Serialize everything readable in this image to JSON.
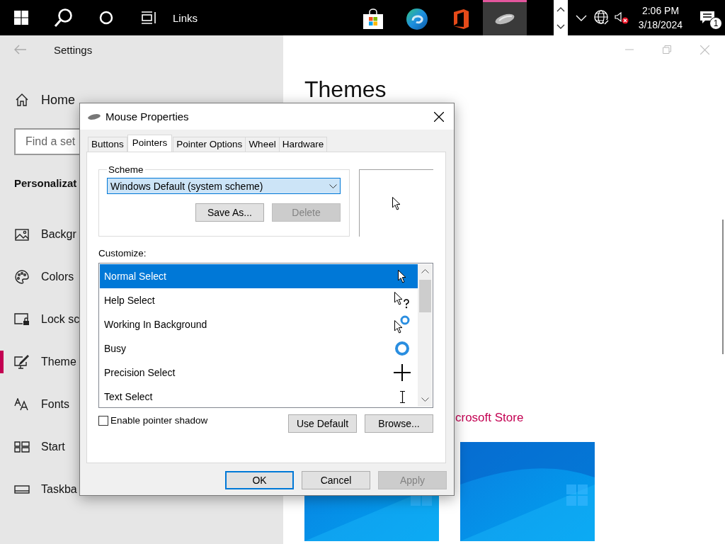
{
  "taskbar": {
    "links_label": "Links",
    "apps": [
      {
        "kind": "store",
        "selected": false
      },
      {
        "kind": "edge",
        "selected": false
      },
      {
        "kind": "office",
        "selected": false
      },
      {
        "kind": "mouse",
        "selected": true
      }
    ],
    "time": "2:06 PM",
    "date": "3/18/2024",
    "notification_count": "1"
  },
  "settings": {
    "title": "Settings",
    "home": "Home",
    "search": {
      "placeholder": "Find a set"
    },
    "section": "Personalizat",
    "items": [
      {
        "kind": "background",
        "label": "Backgr",
        "selected": false
      },
      {
        "kind": "colors",
        "label": "Colors",
        "selected": false
      },
      {
        "kind": "lock",
        "label": "Lock sc",
        "selected": false
      },
      {
        "kind": "themes",
        "label": "Theme",
        "selected": true
      },
      {
        "kind": "fonts",
        "label": "Fonts",
        "selected": false
      },
      {
        "kind": "start",
        "label": "Start",
        "selected": false
      },
      {
        "kind": "taskbar",
        "label": "Taskba",
        "selected": false
      }
    ],
    "heading": "Themes",
    "store_link": "crosoft Store"
  },
  "dialog": {
    "title": "Mouse Properties",
    "tabs": [
      {
        "label": "Buttons",
        "selected": false
      },
      {
        "label": "Pointers",
        "selected": true
      },
      {
        "label": "Pointer Options",
        "selected": false
      },
      {
        "label": "Wheel",
        "selected": false
      },
      {
        "label": "Hardware",
        "selected": false
      }
    ],
    "scheme": {
      "label": "Scheme",
      "value": "Windows Default (system scheme)",
      "buttons": [
        {
          "label": "Save As...",
          "disabled": false
        },
        {
          "label": "Delete",
          "disabled": true
        }
      ]
    },
    "customize_label": "Customize:",
    "pointers": [
      {
        "name": "Normal Select",
        "kind": "arrow",
        "selected": true
      },
      {
        "name": "Help Select",
        "kind": "help",
        "selected": false
      },
      {
        "name": "Working In Background",
        "kind": "working",
        "selected": false
      },
      {
        "name": "Busy",
        "kind": "busy",
        "selected": false
      },
      {
        "name": "Precision Select",
        "kind": "cross",
        "selected": false
      },
      {
        "name": "Text Select",
        "kind": "ibeam",
        "selected": false
      }
    ],
    "shadow": {
      "label": "Enable pointer shadow",
      "checked": false
    },
    "list_buttons": [
      {
        "label": "Use Default",
        "disabled": false
      },
      {
        "label": "Browse...",
        "disabled": false
      }
    ],
    "footer_buttons": [
      {
        "label": "OK",
        "default": true,
        "disabled": false
      },
      {
        "label": "Cancel",
        "default": false,
        "disabled": false
      },
      {
        "label": "Apply",
        "default": false,
        "disabled": true
      }
    ]
  }
}
